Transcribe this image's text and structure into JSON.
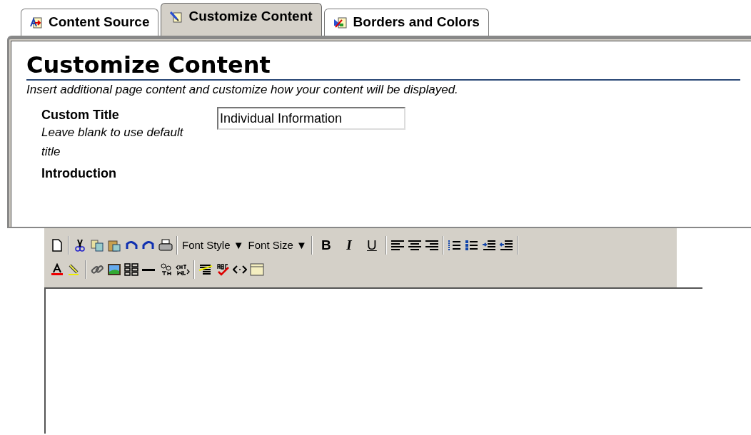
{
  "tabs": [
    {
      "label": "Content Source",
      "selected": false
    },
    {
      "label": "Customize Content",
      "selected": true
    },
    {
      "label": "Borders and Colors",
      "selected": false
    }
  ],
  "heading": "Customize Content",
  "description": "Insert additional page content and customize how your content will be displayed.",
  "custom_title": {
    "label": "Custom Title",
    "hint": "Leave blank to use default title",
    "value": "Individual Information"
  },
  "introduction": {
    "label": "Introduction"
  },
  "toolbar": {
    "dropdowns": [
      "Font Style ▼",
      "Font Size ▼"
    ],
    "format_buttons": [
      "B",
      "I",
      "U"
    ]
  }
}
